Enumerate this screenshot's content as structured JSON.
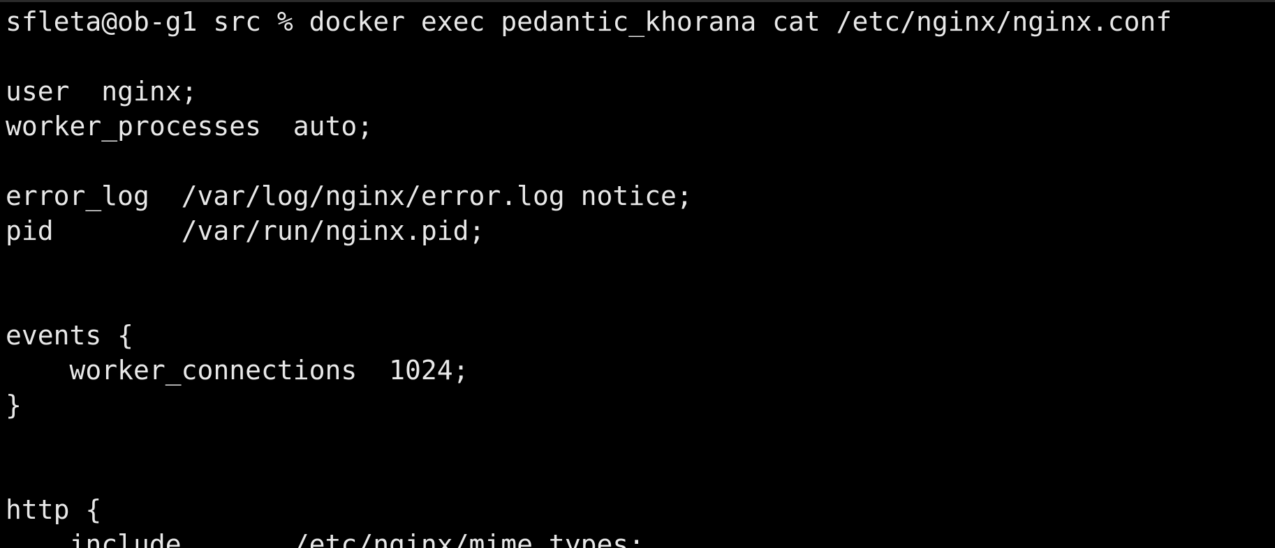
{
  "terminal": {
    "lines": [
      "sfleta@ob-g1 src % docker exec pedantic_khorana cat /etc/nginx/nginx.conf",
      "",
      "user  nginx;",
      "worker_processes  auto;",
      "",
      "error_log  /var/log/nginx/error.log notice;",
      "pid        /var/run/nginx.pid;",
      "",
      "",
      "events {",
      "    worker_connections  1024;",
      "}",
      "",
      "",
      "http {",
      "    include       /etc/nginx/mime.types;"
    ],
    "colors": {
      "background": "#000000",
      "foreground": "#e8e8e8"
    }
  }
}
